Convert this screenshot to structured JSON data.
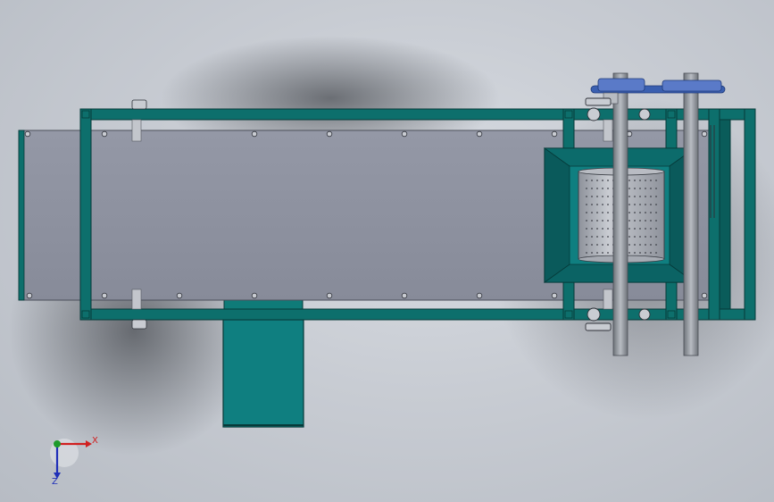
{
  "viewport": {
    "background_top": "#cfd3d9",
    "background_bottom": "#b4b9c1"
  },
  "colors": {
    "frame": "#0d6f6c",
    "frame_dark": "#0a4f4d",
    "frame_edge": "#063a39",
    "plate": "#8f94a3",
    "plate_edge": "#4b4f5a",
    "hopper": "#0f7f80",
    "drum": "#aeb2bb",
    "shaft": "#8a8f96",
    "belt": "#3a5fb0"
  },
  "triad": {
    "x_label": "X",
    "z_label": "Z",
    "x_color": "#d01f1f",
    "y_color": "#1e9a2b",
    "z_color": "#1f2fb8"
  }
}
